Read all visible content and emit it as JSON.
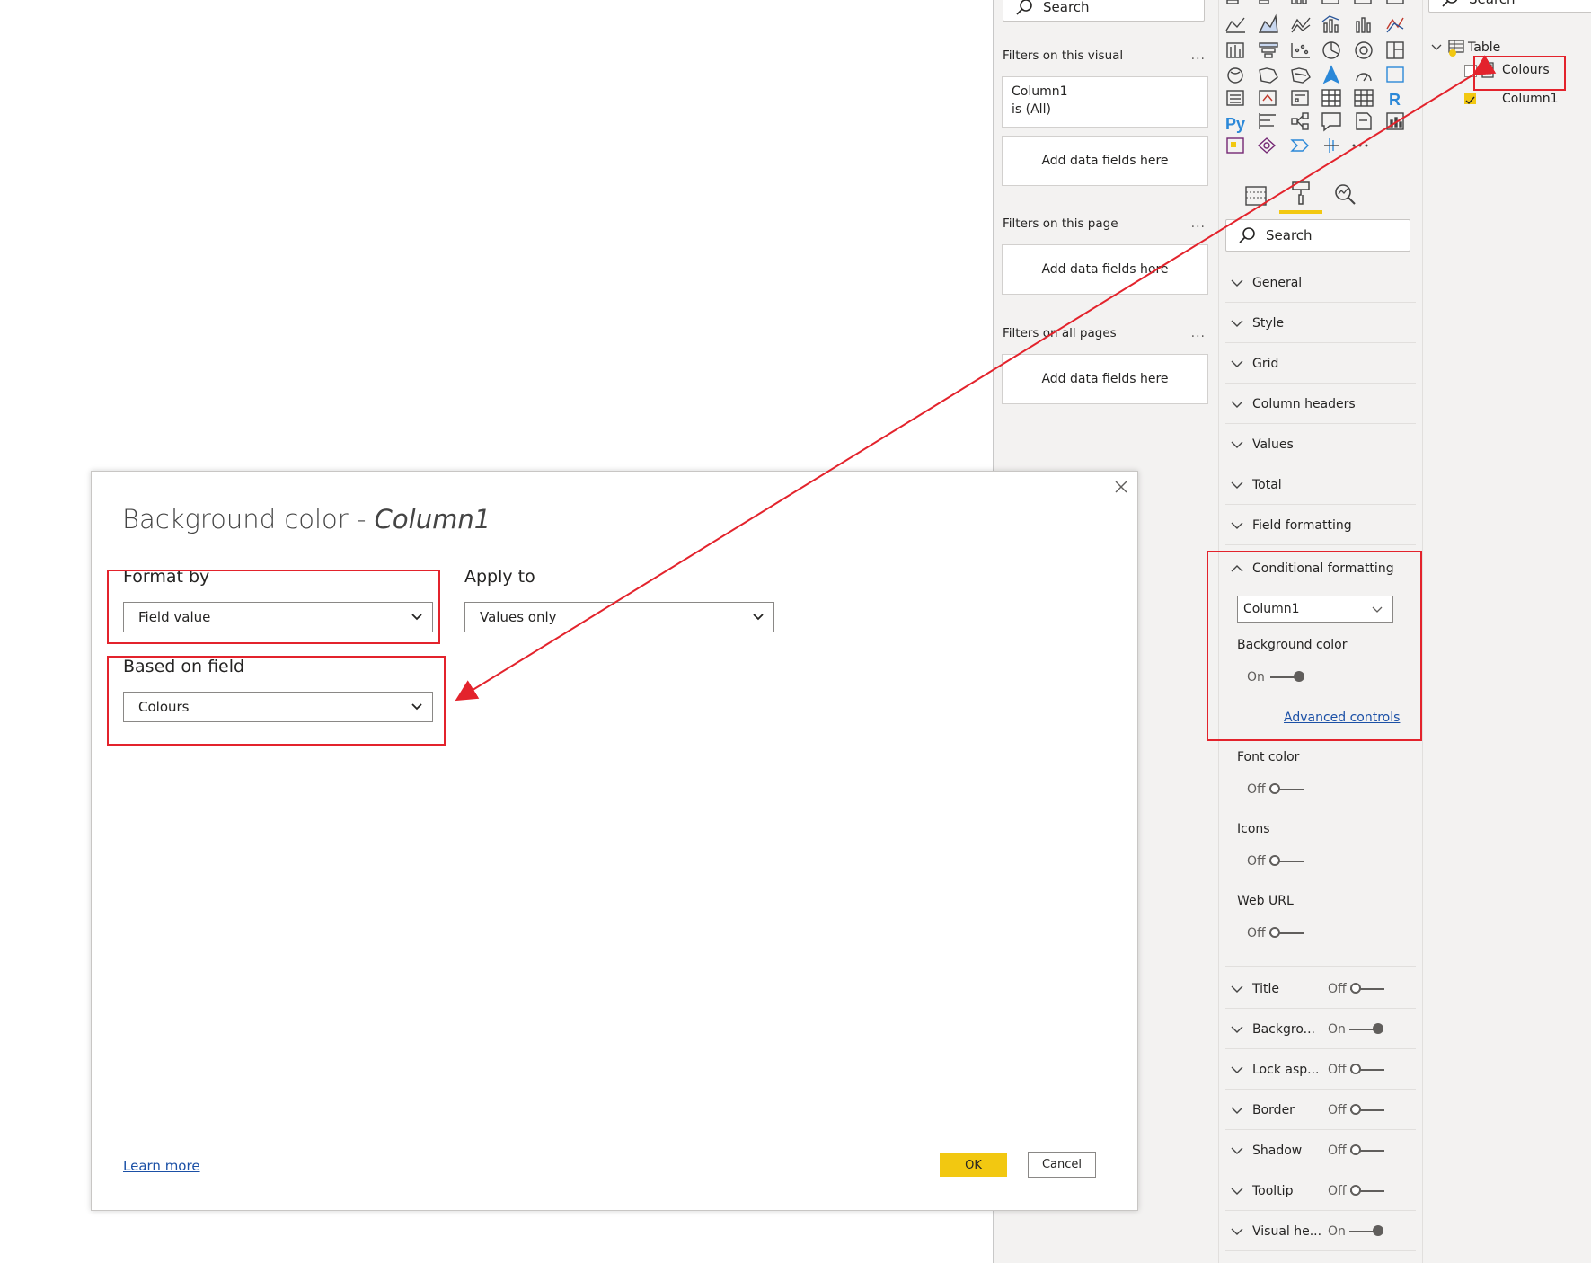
{
  "filters": {
    "search_placeholder": "Search",
    "visual_header": "Filters on this visual",
    "visual_filter_field": "Column1",
    "visual_filter_state": "is (All)",
    "add_fields": "Add data fields here",
    "page_header": "Filters on this page",
    "all_pages_header": "Filters on all pages",
    "more": "..."
  },
  "viz": {
    "search_placeholder": "Search",
    "icons": [
      "stacked-bar",
      "clustered-bar",
      "stacked-column",
      "clustered-column",
      "100-bar",
      "100-column",
      "line",
      "area",
      "stacked-area",
      "line-column",
      "ribbon",
      "waterfall",
      "funnel-like",
      "funnel",
      "scatter",
      "pie",
      "donut",
      "treemap",
      "map",
      "filled-map",
      "shape-map",
      "azure-map",
      "gauge",
      "card",
      "multi-card",
      "kpi",
      "slicer",
      "table",
      "matrix",
      "r-visual",
      "python-visual",
      "key-influencers",
      "decomposition-tree",
      "qa",
      "smart-narrative",
      "paginated",
      "power-apps",
      "custom-a",
      "power-automate",
      "custom-b",
      "more"
    ],
    "python_label": "Py",
    "r_label": "R",
    "sections": [
      {
        "label": "General"
      },
      {
        "label": "Style"
      },
      {
        "label": "Grid"
      },
      {
        "label": "Column headers"
      },
      {
        "label": "Values"
      },
      {
        "label": "Total"
      },
      {
        "label": "Field formatting"
      }
    ],
    "conditional": {
      "label": "Conditional formatting",
      "field_select": "Column1",
      "bg_label": "Background color",
      "bg_state": "On",
      "advanced": "Advanced controls",
      "font_label": "Font color",
      "font_state": "Off",
      "icons_label": "Icons",
      "icons_state": "Off",
      "weburl_label": "Web URL",
      "weburl_state": "Off"
    },
    "bottom_sections": [
      {
        "label": "Title",
        "state": "Off"
      },
      {
        "label": "Backgro...",
        "state": "On"
      },
      {
        "label": "Lock asp...",
        "state": "Off"
      },
      {
        "label": "Border",
        "state": "Off"
      },
      {
        "label": "Shadow",
        "state": "Off"
      },
      {
        "label": "Tooltip",
        "state": "Off"
      },
      {
        "label": "Visual he...",
        "state": "On"
      }
    ]
  },
  "fields": {
    "search_placeholder": "Search",
    "table": "Table",
    "items": [
      "Colours",
      "Column1"
    ]
  },
  "dialog": {
    "title_prefix": "Background color - ",
    "title_field": "Column1",
    "format_by_label": "Format by",
    "format_by_value": "Field value",
    "apply_to_label": "Apply to",
    "apply_to_value": "Values only",
    "based_on_label": "Based on field",
    "based_on_value": "Colours",
    "learn_more": "Learn more",
    "ok": "OK",
    "cancel": "Cancel"
  },
  "colors": {
    "accent_yellow": "#f2c811",
    "highlight_red": "#e3232c",
    "link_blue": "#1b50a6"
  }
}
